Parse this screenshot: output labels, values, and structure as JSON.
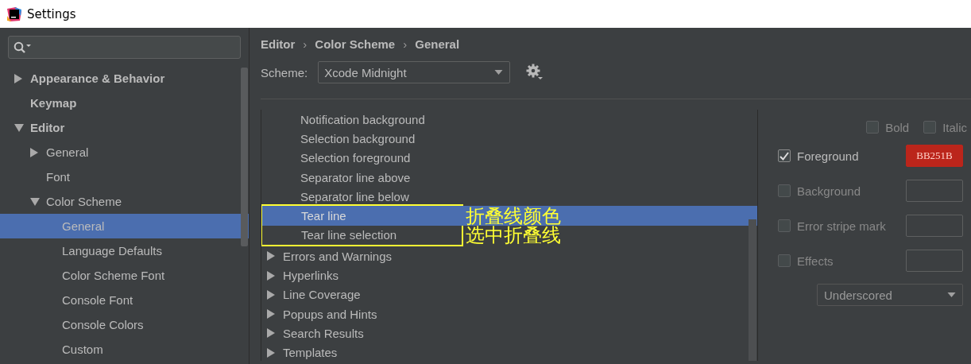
{
  "window": {
    "title": "Settings"
  },
  "sidebar": {
    "items": [
      {
        "label": "Appearance & Behavior",
        "expanded": false,
        "selected": false
      },
      {
        "label": "Keymap",
        "selected": false
      },
      {
        "label": "Editor",
        "expanded": true,
        "selected": false,
        "children": [
          {
            "label": "General",
            "expanded": false,
            "selected": false
          },
          {
            "label": "Font",
            "selected": false
          },
          {
            "label": "Color Scheme",
            "expanded": true,
            "selected": false,
            "children": [
              {
                "label": "General",
                "selected": true
              },
              {
                "label": "Language Defaults",
                "selected": false
              },
              {
                "label": "Color Scheme Font",
                "selected": false
              },
              {
                "label": "Console Font",
                "selected": false
              },
              {
                "label": "Console Colors",
                "selected": false
              },
              {
                "label": "Custom",
                "selected": false
              }
            ]
          }
        ]
      }
    ]
  },
  "breadcrumb": [
    {
      "kind": "crumb",
      "text": "Editor"
    },
    {
      "kind": "separator",
      "text": "›"
    },
    {
      "kind": "crumb",
      "text": "Color Scheme"
    },
    {
      "kind": "separator",
      "text": "›"
    },
    {
      "kind": "crumb",
      "text": "General"
    }
  ],
  "scheme": {
    "label": "Scheme:",
    "value": "Xcode Midnight"
  },
  "attributes": {
    "items": [
      {
        "kind": "option",
        "label": "Notification background",
        "selected": false
      },
      {
        "kind": "option",
        "label": "Selection background",
        "selected": false
      },
      {
        "kind": "option",
        "label": "Selection foreground",
        "selected": false
      },
      {
        "kind": "option",
        "label": "Separator line above",
        "selected": false
      },
      {
        "kind": "option",
        "label": "Separator line below",
        "selected": false
      },
      {
        "kind": "option",
        "label": "Tear line",
        "selected": true,
        "note": "折叠线颜色"
      },
      {
        "kind": "option",
        "label": "Tear line selection",
        "selected": false,
        "note": "选中折叠线"
      },
      {
        "kind": "group",
        "label": "Errors and Warnings",
        "expanded": false,
        "selected": false
      },
      {
        "kind": "group",
        "label": "Hyperlinks",
        "expanded": false,
        "selected": false
      },
      {
        "kind": "group",
        "label": "Line Coverage",
        "expanded": false,
        "selected": false
      },
      {
        "kind": "group",
        "label": "Popups and Hints",
        "expanded": false,
        "selected": false
      },
      {
        "kind": "group",
        "label": "Search Results",
        "expanded": false,
        "selected": false
      },
      {
        "kind": "group",
        "label": "Templates",
        "expanded": false,
        "selected": false
      }
    ]
  },
  "options": {
    "styles": [
      {
        "label": "Bold",
        "checked": false
      },
      {
        "label": "Italic",
        "checked": false
      }
    ],
    "colors": [
      {
        "label": "Foreground",
        "checked": true,
        "value": "BB251B",
        "color": "#bb251b"
      },
      {
        "label": "Background",
        "checked": false
      },
      {
        "label": "Error stripe mark",
        "checked": false
      },
      {
        "label": "Effects",
        "checked": false
      }
    ],
    "effect_type": {
      "value": "Underscored",
      "disabled": true
    }
  }
}
